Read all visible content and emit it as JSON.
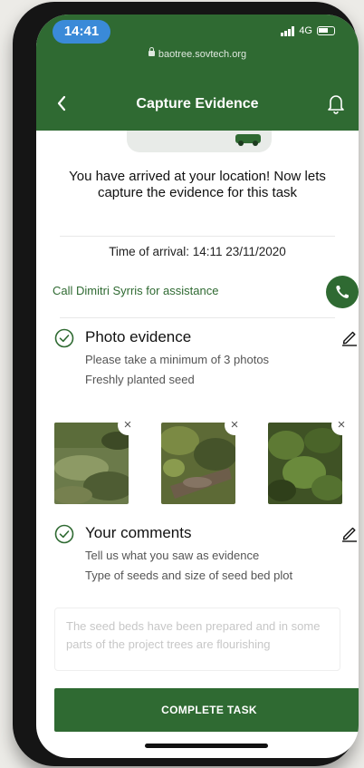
{
  "status_bar": {
    "time": "14:41",
    "network": "4G",
    "url": "baotree.sovtech.org"
  },
  "header": {
    "title": "Capture Evidence"
  },
  "arrival_message": "You have arrived at your location! Now lets capture the evidence for this task",
  "arrival_time": "Time of arrival: 14:11 23/11/2020",
  "call_link": "Call Dimitri Syrris for assistance",
  "photo_section": {
    "title": "Photo evidence",
    "instruction": "Please take a minimum of 3 photos",
    "subtitle": "Freshly planted seed",
    "remove_label": "×"
  },
  "comments_section": {
    "title": "Your comments",
    "instruction": "Tell us what you saw as evidence",
    "subtitle": "Type of seeds and size of seed bed plot",
    "comment_text": "The seed beds have been prepared and in some parts of the project trees are flourishing"
  },
  "complete_button": "COMPLETE TASK",
  "colors": {
    "primary": "#2f6a32",
    "time_pill": "#3a8ad8"
  }
}
